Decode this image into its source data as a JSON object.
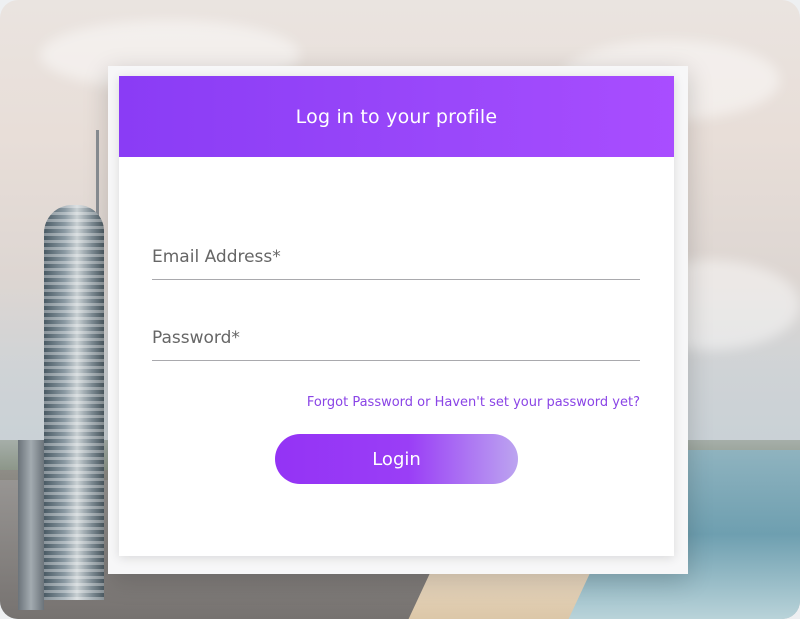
{
  "header": {
    "title": "Log in to your profile"
  },
  "form": {
    "email_placeholder": "Email Address*",
    "password_placeholder": "Password*",
    "forgot_link": "Forgot Password or Haven't set your password yet?",
    "login_label": "Login"
  },
  "colors": {
    "accent": "#9a3ef6",
    "header_gradient_start": "#8a3cf5",
    "header_gradient_end": "#a94dff",
    "link": "#8a44e6"
  }
}
